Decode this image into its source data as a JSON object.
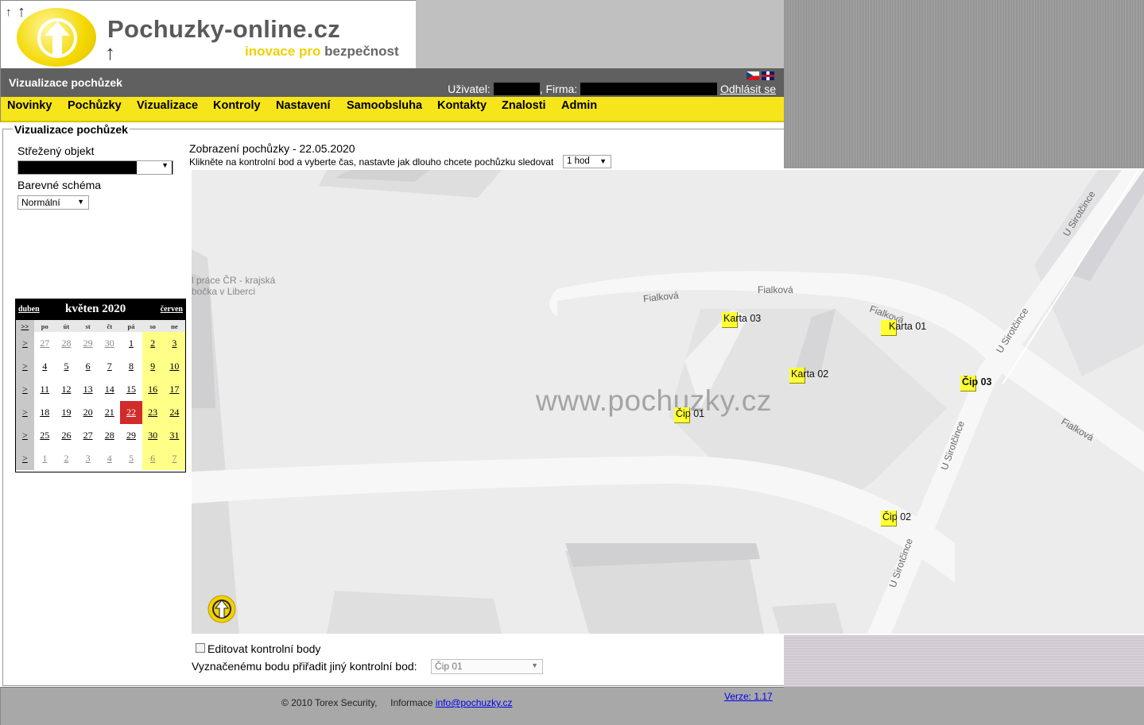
{
  "site": {
    "name": "Pochuzky-online.cz",
    "slogan_a": "inovace pro",
    "slogan_b": "bezpečnost"
  },
  "header": {
    "title": "Vizualizace pochůzek",
    "user_label": "Uživatel:",
    "firm_label": ", Firma:",
    "logout": "Odhlásit se"
  },
  "menu": [
    "Novinky",
    "Pochůzky",
    "Vizualizace",
    "Kontroly",
    "Nastavení",
    "Samoobsluha",
    "Kontakty",
    "Znalosti",
    "Admin"
  ],
  "section_title": "Vizualizace pochůzek",
  "left": {
    "object_label": "Střežený objekt",
    "scheme_label": "Barevné schéma",
    "scheme_value": "Normální"
  },
  "calendar": {
    "prev": "duben",
    "month": "květen 2020",
    "next": "červen",
    "weekcol": ">>",
    "days": [
      "po",
      "út",
      "st",
      "čt",
      "pá",
      "so",
      "ne"
    ],
    "row_marker": ">",
    "weeks": [
      [
        "27",
        "28",
        "29",
        "30",
        "1",
        "2",
        "3"
      ],
      [
        "4",
        "5",
        "6",
        "7",
        "8",
        "9",
        "10"
      ],
      [
        "11",
        "12",
        "13",
        "14",
        "15",
        "16",
        "17"
      ],
      [
        "18",
        "19",
        "20",
        "21",
        "22",
        "23",
        "24"
      ],
      [
        "25",
        "26",
        "27",
        "28",
        "29",
        "30",
        "31"
      ],
      [
        "1",
        "2",
        "3",
        "4",
        "5",
        "6",
        "7"
      ]
    ],
    "selected_day": "22"
  },
  "main": {
    "heading": "Zobrazení pochůzky - 22.05.2020",
    "instruction": "Klikněte na kontrolní bod a vyberte čas, nastavte jak dlouho chcete pochůzku sledovat",
    "duration_value": "1 hod"
  },
  "map": {
    "watermark": "www.pochuzky.cz",
    "streets": [
      "Fialková",
      "Fialková",
      "Fialková",
      "Fialková",
      "U Sirotčince",
      "U Sirotčince",
      "U Sirotčince",
      "U Sirotčince"
    ],
    "poi": [
      "l práce ČR - krajská",
      "bočka v Liberci"
    ],
    "checkpoints": [
      "Karta 03",
      "Karta 01",
      "Karta 02",
      "Čip 03",
      "Čip 01",
      "Čip 02"
    ]
  },
  "controls": {
    "edit_label": "Editovat kontrolní body",
    "assign_label": "Vyznačenému bodu přiřadit jiný kontrolní bod:",
    "assign_value": "Čip 01"
  },
  "footer": {
    "copyright": "© 2010 Torex Security,",
    "info_label": "Informace",
    "email": "info@pochuzky.cz",
    "version": "Verze: 1.17"
  },
  "colors": {
    "menu_bg": "#f7e51b",
    "titlebar_bg": "#606060",
    "checkpoint": "#ffff33",
    "today": "#d12b2b",
    "weekend": "#ffff88"
  }
}
